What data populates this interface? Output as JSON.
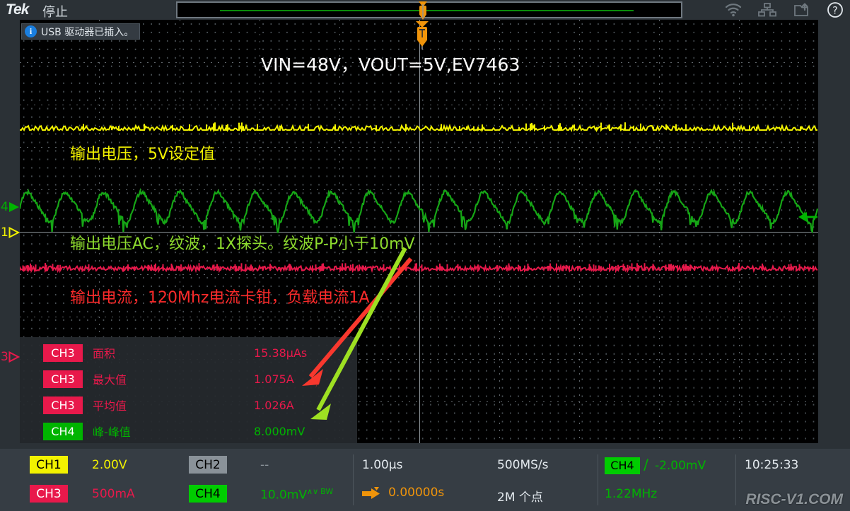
{
  "header": {
    "brand": "Tek",
    "run_state": "停止",
    "icons": [
      "wifi-icon",
      "network-icon",
      "save-icon",
      "help-icon"
    ]
  },
  "notification": {
    "icon": "info-icon",
    "text": "USB 驱动器已插入。"
  },
  "annotations": {
    "title": "VIN=48V，VOUT=5V,EV7463",
    "ch1_note": "输出电压，5V设定值",
    "ch4_note": "输出电压AC，纹波，1X探头。纹波P-P小于10mV",
    "ch3_note": "输出电流，120Mhz电流卡钳，负载电流1A"
  },
  "left_markers": [
    {
      "label": "4",
      "channel": "CH4",
      "color": "#00b400",
      "filled": true
    },
    {
      "label": "1",
      "channel": "CH1",
      "color": "#f2f200",
      "filled": false
    },
    {
      "label": "3",
      "channel": "CH3",
      "color": "#e8194b",
      "filled": false
    }
  ],
  "measurements": {
    "rows": [
      {
        "channel": "CH3",
        "badge_class": "ch3",
        "label": "面积",
        "value": "15.38µAs",
        "color_class": "c-ch3"
      },
      {
        "channel": "CH3",
        "badge_class": "ch3",
        "label": "最大值",
        "value": "1.075A",
        "color_class": "c-ch3"
      },
      {
        "channel": "CH3",
        "badge_class": "ch3",
        "label": "平均值",
        "value": "1.026A",
        "color_class": "c-ch3"
      },
      {
        "channel": "CH4",
        "badge_class": "ch4",
        "label": "峰-峰值",
        "value": "8.000mV",
        "color_class": "c-ch4"
      }
    ]
  },
  "statusbar": {
    "ch1": {
      "name": "CH1",
      "value": "2.00V"
    },
    "ch2": {
      "name": "CH2",
      "value": "--"
    },
    "ch3": {
      "name": "CH3",
      "value": "500mA"
    },
    "ch4": {
      "name": "CH4",
      "value": "10.0mV",
      "coupling": "AC",
      "bw_limit": "BW"
    },
    "timebase": {
      "scale": "1.00µs",
      "position": "0.00000s",
      "position_icon": "trigger-position-icon"
    },
    "acquisition": {
      "sample_rate": "500MS/s",
      "record_length": "2M 个点"
    },
    "trigger": {
      "source": "CH4",
      "slope": "rising-edge-icon",
      "level": "-2.00mV",
      "frequency": "1.22MHz"
    },
    "clock": "10:25:33",
    "watermark": "RISC-V1.COM"
  },
  "colors": {
    "ch1": "#f2f200",
    "ch2": "#8a9299",
    "ch3": "#e8194b",
    "ch4": "#00b400",
    "trigger_orange": "#f0940a",
    "background": "#2b3136",
    "graticule": "#000000"
  }
}
